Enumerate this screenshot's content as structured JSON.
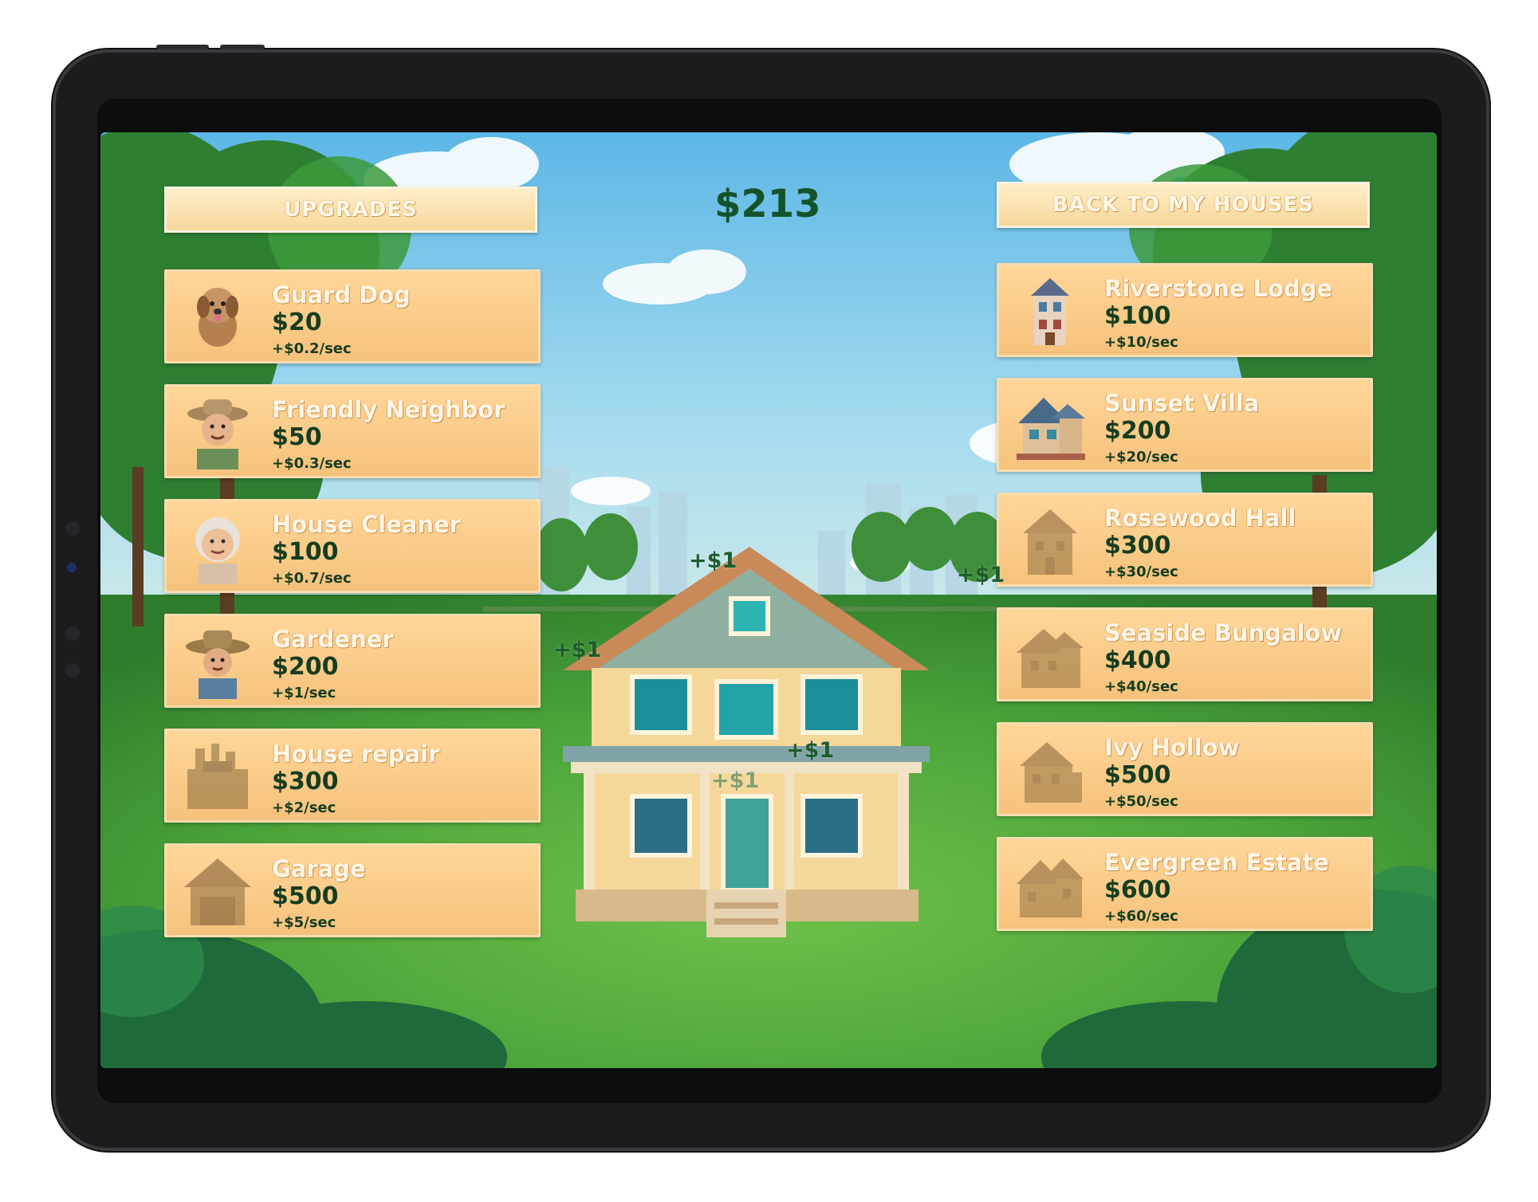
{
  "game": {
    "balance": "$213",
    "upgrades_button": "UPGRADES",
    "back_button": "BACK TO MY HOUSES",
    "upgrades": [
      {
        "name": "Guard Dog",
        "price": "$20",
        "rate": "+$0.2/sec",
        "icon": "dog-icon",
        "locked": false
      },
      {
        "name": "Friendly Neighbor",
        "price": "$50",
        "rate": "+$0.3/sec",
        "icon": "neighbor-icon",
        "locked": false
      },
      {
        "name": "House Cleaner",
        "price": "$100",
        "rate": "+$0.7/sec",
        "icon": "cleaner-icon",
        "locked": false
      },
      {
        "name": "Gardener",
        "price": "$200",
        "rate": "+$1/sec",
        "icon": "gardener-icon",
        "locked": false
      },
      {
        "name": "House repair",
        "price": "$300",
        "rate": "+$2/sec",
        "icon": "toolbox-icon",
        "locked": true
      },
      {
        "name": "Garage",
        "price": "$500",
        "rate": "+$5/sec",
        "icon": "garage-icon",
        "locked": true
      }
    ],
    "houses": [
      {
        "name": "Riverstone Lodge",
        "price": "$100",
        "rate": "+$10/sec",
        "icon": "lodge-icon",
        "locked": false
      },
      {
        "name": "Sunset Villa",
        "price": "$200",
        "rate": "+$20/sec",
        "icon": "villa-icon",
        "locked": false
      },
      {
        "name": "Rosewood Hall",
        "price": "$300",
        "rate": "+$30/sec",
        "icon": "hall-icon",
        "locked": true
      },
      {
        "name": "Seaside Bungalow",
        "price": "$400",
        "rate": "+$40/sec",
        "icon": "bungalow-icon",
        "locked": true
      },
      {
        "name": "Ivy Hollow",
        "price": "$500",
        "rate": "+$50/sec",
        "icon": "hollow-icon",
        "locked": true
      },
      {
        "name": "Evergreen Estate",
        "price": "$600",
        "rate": "+$60/sec",
        "icon": "estate-icon",
        "locked": true
      }
    ],
    "floaters": [
      "+$1",
      "+$1",
      "+$1",
      "+$1",
      "+$1"
    ],
    "colors": {
      "card": "#f7c787",
      "card_text": "#fff6e6",
      "price_text": "#163d1f",
      "balance_text": "#13532b"
    }
  }
}
